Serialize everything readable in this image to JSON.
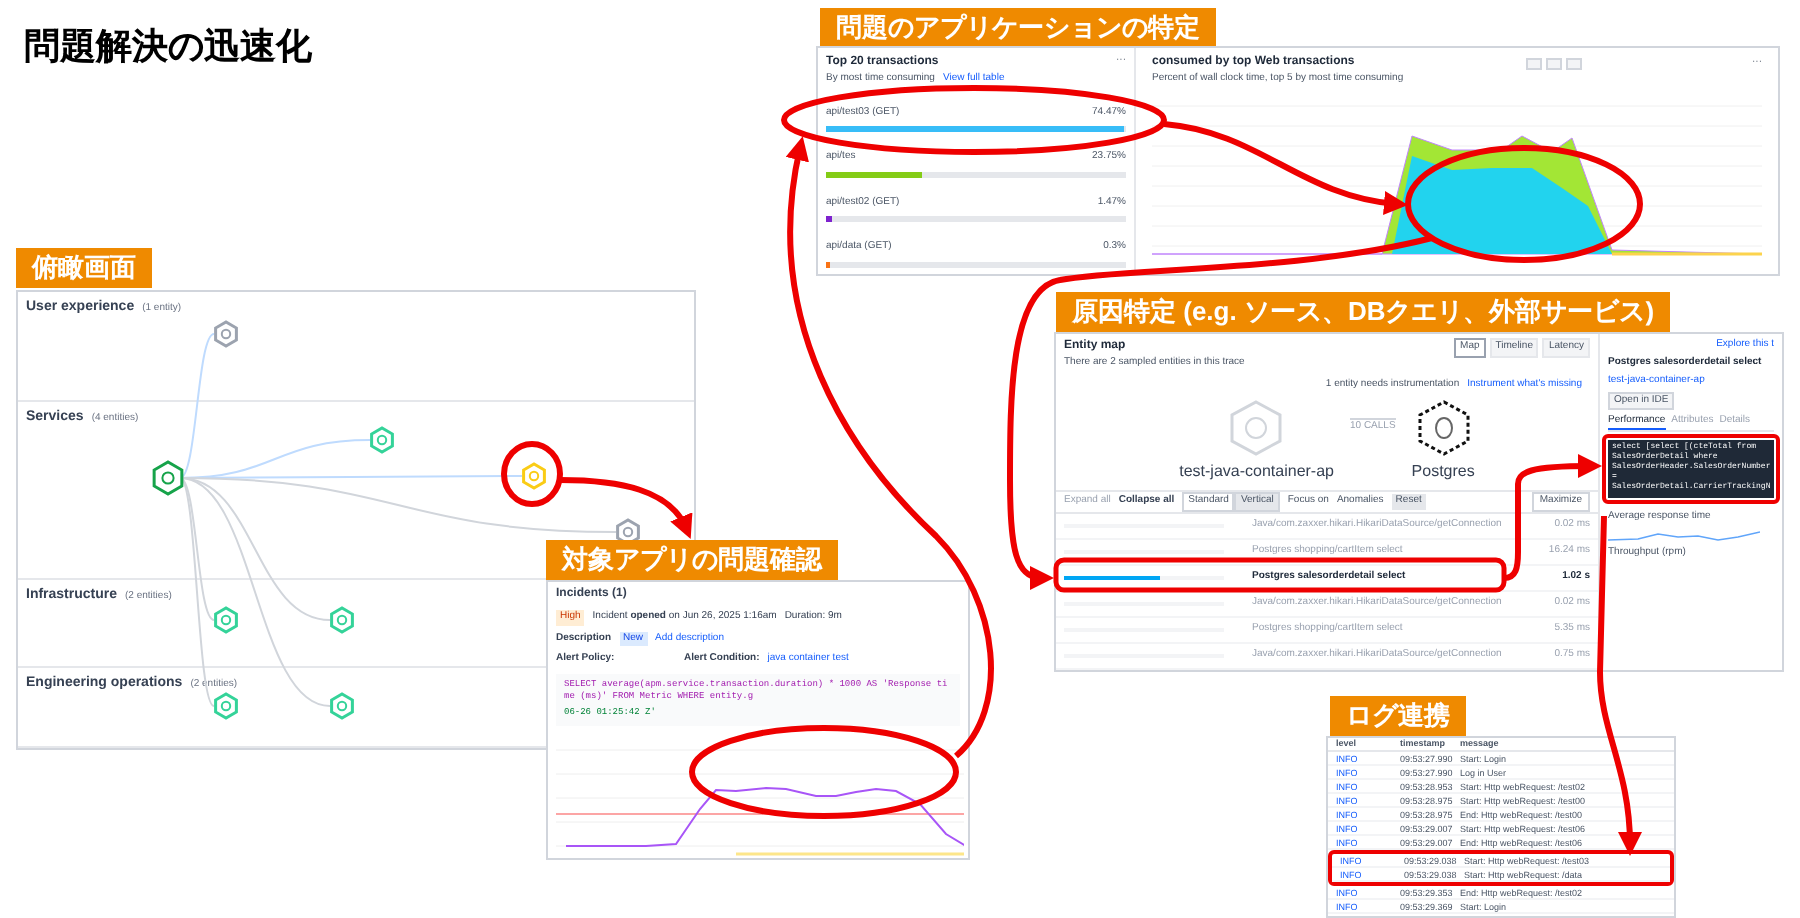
{
  "title": "問題解決の迅速化",
  "overview": {
    "label": "俯瞰画面",
    "sections": [
      {
        "name": "User experience",
        "count": "(1 entity)",
        "nodes": [
          {
            "color": "#9ca3af"
          }
        ]
      },
      {
        "name": "Services",
        "count": "(4 entities)",
        "nodes": [
          {
            "color": "#16a34a"
          },
          {
            "color": "#34d399"
          },
          {
            "color": "#facc15"
          },
          {
            "color": "#9ca3af"
          }
        ]
      },
      {
        "name": "Infrastructure",
        "count": "(2 entities)",
        "nodes": [
          {
            "color": "#34d399"
          },
          {
            "color": "#34d399"
          }
        ]
      },
      {
        "name": "Engineering operations",
        "count": "(2 entities)",
        "nodes": [
          {
            "color": "#34d399"
          },
          {
            "color": "#34d399"
          }
        ]
      }
    ]
  },
  "incident": {
    "label": "対象アプリの問題確認",
    "title": "Incidents (1)",
    "priority": "High",
    "opened": "Incident **opened** on Jun 26, 2025 1:16am",
    "duration": "Duration: 9m",
    "description_label": "Description",
    "description_badge": "New",
    "description_link": "Add description",
    "policy_label": "Alert Policy:",
    "condition_label": "Alert Condition:",
    "condition_value": "java container test",
    "query": [
      "SELECT average(apm.service.transaction.duration) * 1000 AS 'Response time (ms)' FROM Metric WHERE entity.g",
      "06-26 01:25:42 Z'"
    ]
  },
  "transactions": {
    "label": "問題のアプリケーションの特定",
    "title": "Top 20 transactions",
    "subtitle": "By most time consuming",
    "link": "View full table",
    "menu": "···",
    "rows": [
      {
        "name": "api/test03 (GET)",
        "value": "74.47%",
        "level": 0.99,
        "color": "#38bdf8"
      },
      {
        "name": "api/tes",
        "value": "23.75%",
        "level": 0.32,
        "color": "#84cc16"
      },
      {
        "name": "api/test02 (GET)",
        "value": "1.47%",
        "level": 0.02,
        "color": "#7e22ce"
      },
      {
        "name": "api/data (GET)",
        "value": "0.3%",
        "level": 0.01,
        "color": "#f97316"
      }
    ]
  },
  "time_chart": {
    "title": "consumed by top Web transactions",
    "subtitle": "Percent of wall clock time, top 5 by most time consuming",
    "menu": "···"
  },
  "entity_map": {
    "label": "原因特定 (e.g. ソース、DBクエリ、外部サービス)",
    "title": "Entity map",
    "subtitle": "There are 2 sampled entities in this trace",
    "views": [
      {
        "label": "Map",
        "selected": true
      },
      {
        "label": "Timeline",
        "selected": false
      },
      {
        "label": "Latency",
        "selected": false
      }
    ],
    "notice": "1 entity needs instrumentation",
    "notice_link": "Instrument what's missing",
    "calls": "10 CALLS",
    "source": "test-java-container-ap",
    "target": "Postgres",
    "toolbar": {
      "expand": "Expand all",
      "collapse": "Collapse all",
      "modes": [
        {
          "label": "Standard",
          "selected": false
        },
        {
          "label": "Vertical",
          "selected": true
        }
      ],
      "focus": "Focus on",
      "anomalies": "Anomalies",
      "reset": "Reset",
      "maximize": "Maximize"
    },
    "spans": [
      {
        "name": "Java/com.zaxxer.hikari.HikariDataSource/getConnection",
        "duration": "0.02 ms",
        "selected": false
      },
      {
        "name": "Postgres shopping/cartItem select",
        "duration": "16.24 ms",
        "selected": false
      },
      {
        "name": "Postgres salesorderdetail select",
        "duration": "1.02 s",
        "selected": true
      },
      {
        "name": "Java/com.zaxxer.hikari.HikariDataSource/getConnection",
        "duration": "0.02 ms",
        "selected": false
      },
      {
        "name": "Postgres shopping/cartItem select",
        "duration": "5.35 ms",
        "selected": false
      },
      {
        "name": "Java/com.zaxxer.hikari.HikariDataSource/getConnection",
        "duration": "0.75 ms",
        "selected": false
      }
    ],
    "detail": {
      "explore": "Explore this t",
      "title": "Postgres salesorderdetail select",
      "entity": "test-java-container-ap",
      "ide": "Open in IDE",
      "tabs": [
        {
          "label": "Performance",
          "selected": true
        },
        {
          "label": "Attributes",
          "selected": false
        },
        {
          "label": "Details",
          "selected": false
        }
      ],
      "sql": [
        "select [select [(cteTotal from",
        "SalesOrderDetail where",
        "SalesOrderHeader.SalesOrderNumber",
        "=",
        "SalesOrderDetail.CarrierTrackingN"
      ],
      "avg": "Average response time",
      "throughput": "Throughput (rpm)"
    }
  },
  "logs": {
    "label": "ログ連携",
    "columns": [
      "level",
      "timestamp",
      "message"
    ],
    "rows": [
      {
        "level": "INFO",
        "timestamp": "09:53:27.990",
        "message": "Start: Login"
      },
      {
        "level": "INFO",
        "timestamp": "09:53:27.990",
        "message": "Log in User"
      },
      {
        "level": "INFO",
        "timestamp": "09:53:28.953",
        "message": "Start: Http webRequest: /test02"
      },
      {
        "level": "INFO",
        "timestamp": "09:53:28.975",
        "message": "Start: Http webRequest: /test00"
      },
      {
        "level": "INFO",
        "timestamp": "09:53:28.975",
        "message": "End: Http webRequest: /test00"
      },
      {
        "level": "INFO",
        "timestamp": "09:53:29.007",
        "message": "Start: Http webRequest: /test06"
      },
      {
        "level": "INFO",
        "timestamp": "09:53:29.007",
        "message": "End: Http webRequest: /test06"
      },
      {
        "level": "INFO",
        "timestamp": "09:53:29.038",
        "message": "Start: Http webRequest: /test03"
      },
      {
        "level": "INFO",
        "timestamp": "09:53:29.038",
        "message": "Start: Http webRequest: /data"
      },
      {
        "level": "INFO",
        "timestamp": "09:53:29.353",
        "message": "End: Http webRequest: /test02"
      },
      {
        "level": "INFO",
        "timestamp": "09:53:29.369",
        "message": "Start: Login"
      }
    ]
  }
}
